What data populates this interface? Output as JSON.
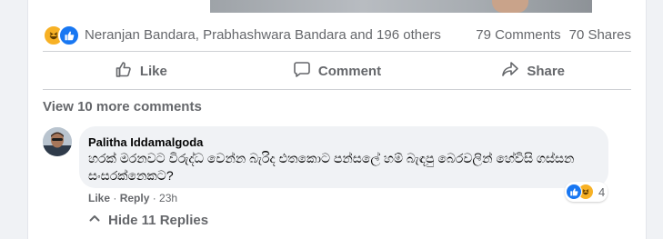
{
  "post": {
    "reactions": {
      "icons": [
        "haha-icon",
        "like-icon"
      ],
      "names_text": "Neranjan Bandara, Prabhashwara Bandara and 196 others",
      "comments_text": "79 Comments",
      "shares_text": "70 Shares"
    },
    "actions": {
      "like_label": "Like",
      "comment_label": "Comment",
      "share_label": "Share"
    },
    "view_more_comments": "View 10 more comments"
  },
  "comment": {
    "author": "Palitha Iddamalgoda",
    "text": "හරක් මරනවට විරුද්ධ වෙන්න බැරිද එතකොට පන්සලේ හම් බැඳපු බෙරවලින් හේවිසි ගස්සන සංසරක්නෙකට?",
    "reaction_icons": [
      "like-icon",
      "haha-icon"
    ],
    "reaction_count": "4",
    "like_label": "Like",
    "separator": " · ",
    "reply_label": "Reply",
    "time": "23h",
    "hide_replies_label": "Hide 11 Replies"
  },
  "colors": {
    "like_blue": "#1877f2",
    "haha_yellow": "#f7b125",
    "secondary_text": "#65676b",
    "bubble_bg": "#f0f2f5"
  }
}
